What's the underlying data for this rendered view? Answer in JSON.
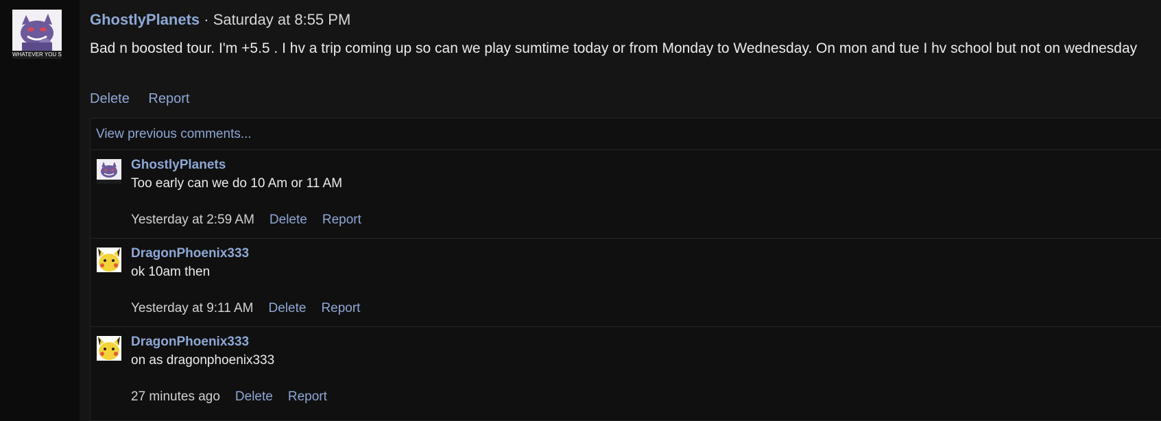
{
  "post": {
    "author": "GhostlyPlanets",
    "separator": " · ",
    "date": "Saturday at 8:55 PM",
    "body": "Bad n boosted tour. I'm +5.5 . I hv a trip coming up so can we play sumtime today or from Monday to Wednesday. On mon and tue I hv school but not on wednesday",
    "delete_label": "Delete",
    "report_label": "Report",
    "avatar_caption": "WHATEVER YOU SAY"
  },
  "comments": {
    "view_previous": "View previous comments...",
    "items": [
      {
        "author": "GhostlyPlanets",
        "text": "Too early can we do 10 Am or 11 AM",
        "time": "Yesterday at 2:59 AM",
        "delete_label": "Delete",
        "report_label": "Report",
        "avatar": "gengar-avatar"
      },
      {
        "author": "DragonPhoenix333",
        "text": "ok 10am then",
        "time": "Yesterday at 9:11 AM",
        "delete_label": "Delete",
        "report_label": "Report",
        "avatar": "pikachu-avatar"
      },
      {
        "author": "DragonPhoenix333",
        "text": "on as dragonphoenix333",
        "time": "27 minutes ago",
        "delete_label": "Delete",
        "report_label": "Report",
        "avatar": "pikachu-avatar"
      }
    ]
  },
  "colors": {
    "background": "#151515",
    "sidebar": "#0c0c0c",
    "link": "#8ea8d6",
    "text": "#ececec"
  }
}
